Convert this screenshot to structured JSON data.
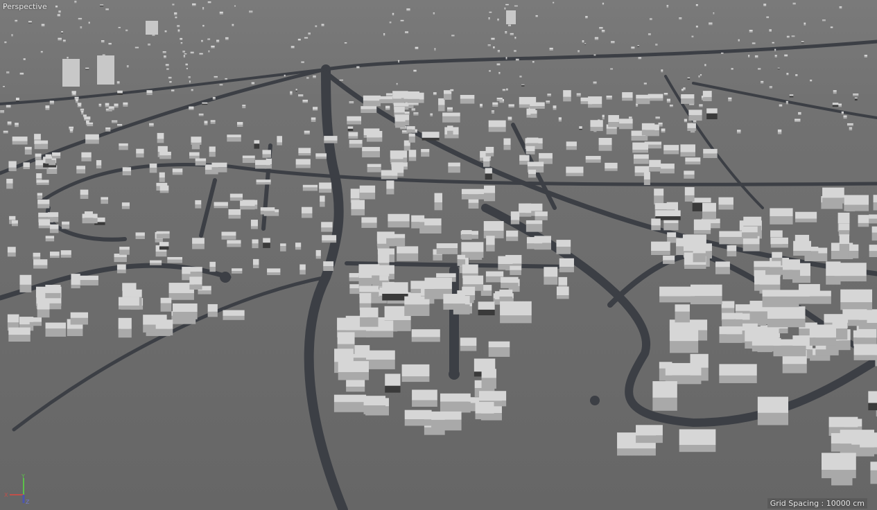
{
  "viewport": {
    "camera_label": "Perspective",
    "grid_spacing": "Grid Spacing : 10000 cm",
    "axis_labels": {
      "x": "X",
      "y": "Y",
      "z": "Z"
    }
  },
  "colors": {
    "ground": "#6e6e6e",
    "road": "#3c3f45",
    "building_top": "#d6d6d6",
    "building_side": "#a9a9a9"
  }
}
